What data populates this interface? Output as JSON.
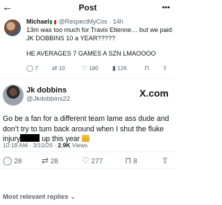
{
  "header": {
    "back_icon": "←",
    "title": "Post",
    "more_icon": "•••"
  },
  "reply": {
    "name": "Michael",
    "handle_time": "@RespectMyCos · 14h",
    "text_line1": "13m was too much for Travis Etienne… but we paid JK DOBBINS 10 a YEAR?????",
    "text_line2": "HE AVERAGES 7 GAMES A SZN LMAOOOO",
    "actions": {
      "reply_icon": "◯",
      "reply_count": "7",
      "repost_icon": "⇄",
      "repost_count": "10",
      "like_icon": "♡",
      "like_count": "180",
      "views_icon": "▮",
      "views_count": "12K",
      "bookmark_icon": "⊓",
      "share_icon": "⇧"
    }
  },
  "post": {
    "name": "Jk dobbins",
    "handle": "@Jkdobbins22",
    "source_logo": "X.com",
    "text_part1": "Go be a fan for a different team lame ass dude and don’t try to turn back around when I shut the fluke injury",
    "text_part2": " up this year",
    "timestamp": "10:18 AM · 3/10/26 · ",
    "views_count": "2.9K",
    "views_label": " Views",
    "stats": {
      "reply_icon": "◯",
      "reply_count": "28",
      "repost_icon": "⇄",
      "repost_count": "28",
      "like_icon": "♡",
      "like_count": "277",
      "bookmark_icon": "⊓",
      "bookmark_count": "8",
      "share_icon": "⇧"
    }
  },
  "footer": {
    "sort_label": "Most relevant replies",
    "sort_icon": "⌄"
  }
}
